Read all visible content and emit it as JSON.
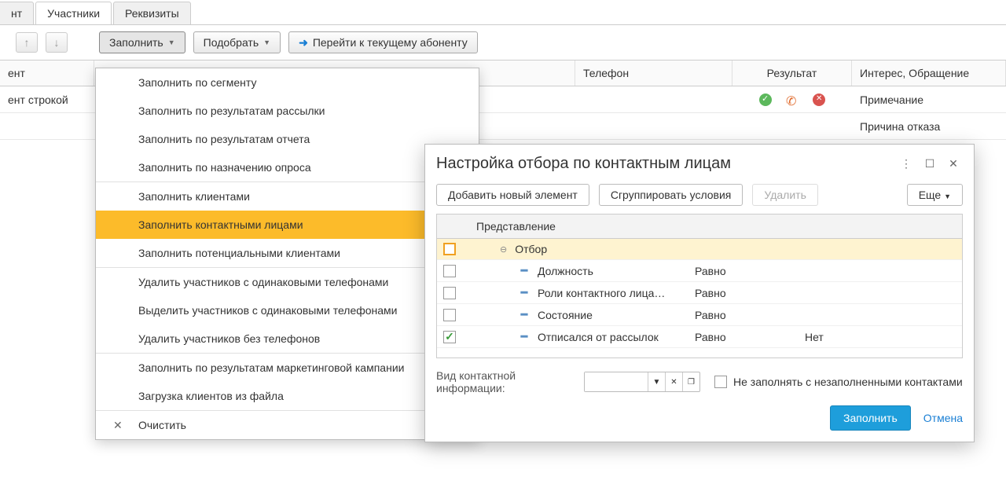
{
  "tabs": {
    "partial": "нт",
    "participants": "Участники",
    "details": "Реквизиты"
  },
  "toolbar": {
    "fill": "Заполнить",
    "select": "Подобрать",
    "goto_current": "Перейти к текущему абоненту"
  },
  "grid": {
    "headers": {
      "left1": "ент",
      "phone": "Телефон",
      "result": "Результат",
      "interest": "Интерес, Обращение"
    },
    "row2": {
      "left": "ент строкой",
      "note": "Примечание"
    },
    "row3": {
      "reason": "Причина отказа"
    }
  },
  "menu": {
    "items": [
      "Заполнить по сегменту",
      "Заполнить по результатам рассылки",
      "Заполнить по результатам отчета",
      "Заполнить по назначению опроса",
      "Заполнить клиентами",
      "Заполнить контактными лицами",
      "Заполнить потенциальными клиентами",
      "Удалить участников с одинаковыми телефонами",
      "Выделить участников с одинаковыми телефонами",
      "Удалить участников без телефонов",
      "Заполнить по результатам маркетинговой кампании",
      "Загрузка клиентов из файла",
      "Очистить"
    ]
  },
  "dialog": {
    "title": "Настройка отбора по контактным лицам",
    "add_element": "Добавить новый элемент",
    "group_conditions": "Сгруппировать условия",
    "delete": "Удалить",
    "more": "Еще",
    "representation_header": "Представление",
    "filter_root": "Отбор",
    "rows": [
      {
        "name": "Должность",
        "cond": "Равно",
        "val": ""
      },
      {
        "name": "Роли контактного лица…",
        "cond": "Равно",
        "val": ""
      },
      {
        "name": "Состояние",
        "cond": "Равно",
        "val": ""
      },
      {
        "name": "Отписался от рассылок",
        "cond": "Равно",
        "val": "Нет"
      }
    ],
    "contact_type_label": "Вид контактной информации:",
    "skip_empty_label": "Не заполнять с незаполненными контактами",
    "fill_btn": "Заполнить",
    "cancel": "Отмена"
  }
}
